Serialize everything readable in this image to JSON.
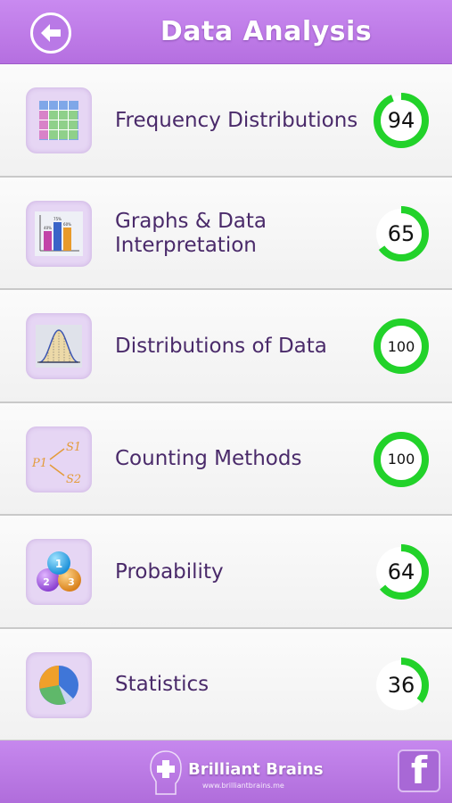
{
  "header": {
    "title": "Data Analysis",
    "back_icon": "arrow-left-icon"
  },
  "items": [
    {
      "label_line1": "Frequency Distributions",
      "label_line2": "",
      "score": "94",
      "progress": 0.94,
      "icon": "frequency-table-icon"
    },
    {
      "label_line1": "Graphs & Data",
      "label_line2": "Interpretation",
      "score": "65",
      "progress": 0.65,
      "icon": "bar-graph-icon"
    },
    {
      "label_line1": "Distributions of Data",
      "label_line2": "",
      "score": "100",
      "progress": 1.0,
      "icon": "bell-curve-icon"
    },
    {
      "label_line1": "Counting Methods",
      "label_line2": "",
      "score": "100",
      "progress": 1.0,
      "icon": "tree-diagram-icon"
    },
    {
      "label_line1": "Probability",
      "label_line2": "",
      "score": "64",
      "progress": 0.64,
      "icon": "probability-balls-icon"
    },
    {
      "label_line1": "Statistics",
      "label_line2": "",
      "score": "36",
      "progress": 0.36,
      "icon": "pie-chart-icon"
    }
  ],
  "thumb_text": {
    "tree_p": "P1",
    "tree_s1": "S1",
    "tree_s2": "S2",
    "ball1": "1",
    "ball2": "2",
    "ball3": "3",
    "bar_labels": [
      "40%",
      "75%",
      "60%"
    ]
  },
  "footer": {
    "brand_name": "Brilliant Brains",
    "brand_url": "www.brilliantbrains.me",
    "facebook_label": "f"
  },
  "colors": {
    "header": "#c07ae8",
    "ring": "#22d22a",
    "label": "#4a2a6a"
  }
}
